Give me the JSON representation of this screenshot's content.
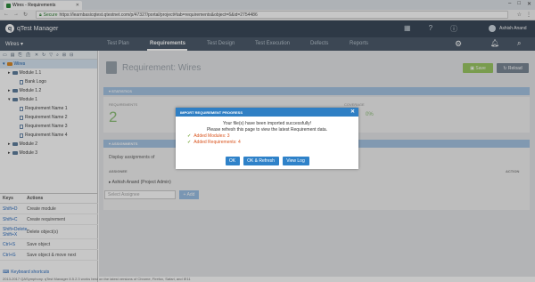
{
  "browser": {
    "tab_title": "Wires - Requirements",
    "secure_label": "Secure",
    "url": "https://learnbasicqtest.qtestnet.com/p/47327/portal/project#tab=requirements&object=6&id=2754486"
  },
  "app": {
    "logo_text": "qTest Manager",
    "user_name": "Ashish Anand",
    "project_name": "Wires"
  },
  "nav": {
    "items": [
      "Test Plan",
      "Requirements",
      "Test Design",
      "Test Execution",
      "Defects",
      "Reports"
    ],
    "active": "Requirements"
  },
  "tree": {
    "root": "Wires",
    "nodes": [
      {
        "label": "Module 1.1",
        "type": "folder",
        "indent": 1
      },
      {
        "label": "Bank Logo",
        "type": "doc",
        "indent": 2
      },
      {
        "label": "Module 1.2",
        "type": "folder",
        "indent": 1
      },
      {
        "label": "Module 1",
        "type": "folder",
        "indent": 1
      },
      {
        "label": "Requirement Name 1",
        "type": "doc",
        "indent": 2
      },
      {
        "label": "Requirement Name 2",
        "type": "doc",
        "indent": 2
      },
      {
        "label": "Requirement Name 3",
        "type": "doc",
        "indent": 2
      },
      {
        "label": "Requirement Name 4",
        "type": "doc",
        "indent": 2
      },
      {
        "label": "Module 2",
        "type": "folder",
        "indent": 1
      },
      {
        "label": "Module 3",
        "type": "folder",
        "indent": 1
      }
    ]
  },
  "shortcuts": {
    "col_keys": "Keys",
    "col_actions": "Actions",
    "rows": [
      {
        "key": "Shift+D",
        "action": "Create module"
      },
      {
        "key": "Shift+C",
        "action": "Create requirement"
      },
      {
        "key": "Shift+Delete, Shift+X",
        "action": "Delete object(s)"
      },
      {
        "key": "Ctrl+S",
        "action": "Save object"
      },
      {
        "key": "Ctrl+G",
        "action": "Save object & move next"
      }
    ],
    "link": "Keyboard shortcuts"
  },
  "footer": {
    "text": "2013-2017 QASymphony.   qTest Manager 8.5.2.3 works best on the latest versions of Chrome, Firefox, Safari, and IE11"
  },
  "requirement": {
    "title": "Requirement: Wires",
    "save_label": "Save",
    "reload_label": "Reload",
    "statistics_label": "STATISTICS",
    "requirements_label": "REQUIREMENTS",
    "requirements_value": "2",
    "coverage_label": "COVERAGE",
    "coverage_value": "0%",
    "assignments_label": "ASSIGNMENTS",
    "display_assignments": "Display assignments of",
    "col_assignee": "ASSIGNEE",
    "col_action": "ACTION",
    "assignee_row": "Ashish Anand (Project Admin)",
    "select_placeholder": "Select Assignee",
    "add_label": "+ Add"
  },
  "modal": {
    "title": "IMPORT REQUIREMENT PROGRESS",
    "message_1": "Your file(s) have been imported successfully!",
    "message_2": "Please refresh this page to view the latest Requirement data.",
    "added_modules": "Added Modules: 3",
    "added_requirements": "Added Requirements: 4",
    "btn_ok": "OK",
    "btn_ok_refresh": "OK & Refresh",
    "btn_view_log": "View Log",
    "close_icon": "close-icon"
  },
  "colors": {
    "header": "#3c4a5a",
    "nav": "#4d5c6c",
    "modal_header": "#2f7fc4",
    "save": "#9bc865",
    "added_text": "#d9541e"
  }
}
